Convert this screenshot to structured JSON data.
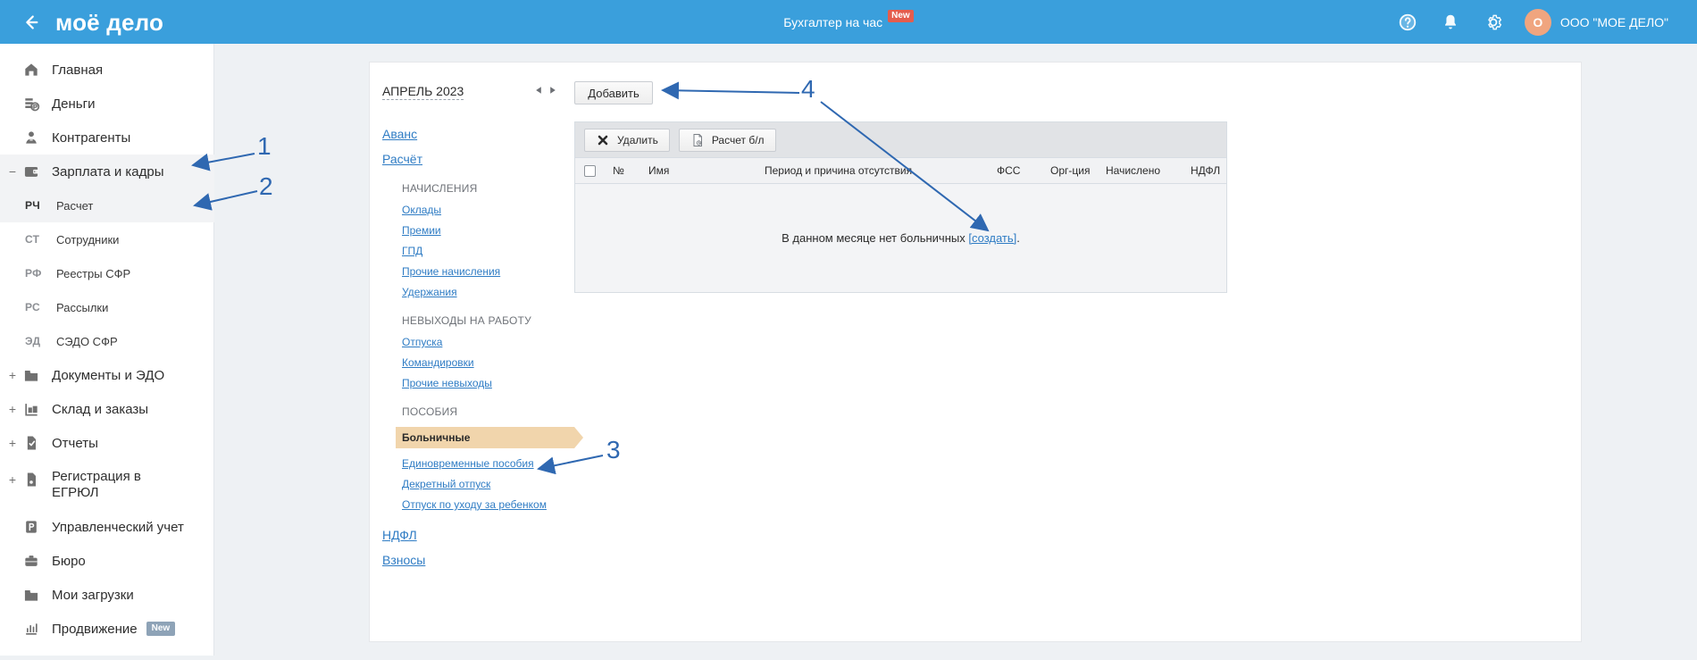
{
  "topbar": {
    "logo": "моё дело",
    "center_title": "Бухгалтер на час",
    "center_badge": "New",
    "company_initial": "О",
    "company_name": "ООО \"МОЕ ДЕЛО\""
  },
  "sidebar": {
    "items": [
      {
        "label": "Главная",
        "icon": "home-icon",
        "has_expander": false
      },
      {
        "label": "Деньги",
        "icon": "money-icon",
        "has_expander": false
      },
      {
        "label": "Контрагенты",
        "icon": "contacts-icon",
        "has_expander": false
      },
      {
        "label": "Зарплата и кадры",
        "icon": "payroll-icon",
        "has_expander": true,
        "expander": "−"
      }
    ],
    "subitems": [
      {
        "abbr": "РЧ",
        "label": "Расчет"
      },
      {
        "abbr": "СТ",
        "label": "Сотрудники"
      },
      {
        "abbr": "РФ",
        "label": "Реестры СФР"
      },
      {
        "abbr": "РС",
        "label": "Рассылки"
      },
      {
        "abbr": "ЭД",
        "label": "СЭДО СФР"
      }
    ],
    "more_items": [
      {
        "label": "Документы и ЭДО",
        "icon": "folder-icon",
        "has_expander": true,
        "expander": "+"
      },
      {
        "label": "Склад и заказы",
        "icon": "warehouse-icon",
        "has_expander": true,
        "expander": "+"
      },
      {
        "label": "Отчеты",
        "icon": "report-icon",
        "has_expander": true,
        "expander": "+"
      },
      {
        "label": "Регистрация в ЕГРЮЛ",
        "icon": "registration-icon",
        "has_expander": true,
        "expander": "+"
      },
      {
        "label": "Управленческий учет",
        "icon": "management-icon",
        "has_expander": false
      },
      {
        "label": "Бюро",
        "icon": "briefcase-icon",
        "has_expander": false
      },
      {
        "label": "Мои загрузки",
        "icon": "downloads-icon",
        "has_expander": false
      },
      {
        "label": "Продвижение",
        "icon": "promotion-icon",
        "has_expander": false,
        "badge": "New"
      }
    ]
  },
  "main": {
    "month_label": "АПРЕЛЬ 2023",
    "left_menu": {
      "top_links": [
        "Аванс",
        "Расчёт"
      ],
      "sections": [
        {
          "title": "НАЧИСЛЕНИЯ",
          "links": [
            "Оклады",
            "Премии",
            "ГПД",
            "Прочие начисления",
            "Удержания"
          ]
        },
        {
          "title": "НЕВЫХОДЫ НА РАБОТУ",
          "links": [
            "Отпуска",
            "Командировки",
            "Прочие невыходы"
          ]
        },
        {
          "title": "ПОСОБИЯ",
          "selected": "Больничные",
          "links": [
            "Единовременные пособия",
            "Декретный отпуск",
            "Отпуск по уходу за ребенком"
          ]
        }
      ],
      "bottom_links": [
        "НДФЛ",
        "Взносы"
      ]
    },
    "toolbar": {
      "add_label": "Добавить",
      "delete_label": "Удалить",
      "calc_label": "Расчет б/л"
    },
    "grid": {
      "headers": [
        "№",
        "Имя",
        "Период и причина отсутствия",
        "ФСС",
        "Орг-ция",
        "Начислено",
        "НДФЛ"
      ],
      "empty_text": "В данном месяце нет больничных",
      "empty_link": "[создать]",
      "empty_tail": "."
    }
  },
  "annotations": {
    "numbers": [
      "1",
      "2",
      "3",
      "4"
    ],
    "color": "#2f68b1"
  }
}
